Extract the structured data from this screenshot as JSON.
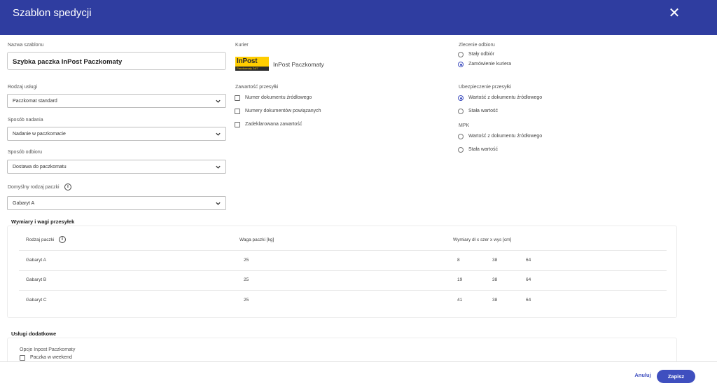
{
  "header": {
    "title": "Szablon spedycji",
    "close_icon": "close-icon"
  },
  "template_name": {
    "label": "Nazwa szablonu",
    "value": "Szybka paczka InPost Paczkomaty"
  },
  "courier": {
    "label": "Kurier",
    "logo_text": "InPost",
    "logo_subtext": "Paczkomaty 24/7",
    "name": "InPost Paczkomaty"
  },
  "pickup_order": {
    "label": "Zlecenie odbioru",
    "options": [
      {
        "label": "Stały odbiór",
        "selected": false
      },
      {
        "label": "Zamówienie kuriera",
        "selected": true
      }
    ]
  },
  "service_type": {
    "label": "Rodzaj usługi",
    "value": "Paczkomat standard"
  },
  "shipment_content": {
    "label": "Zawartość przesyłki",
    "options": [
      {
        "label": "Numer dokumentu źródłowego",
        "checked": false
      },
      {
        "label": "Numery dokumentów powiązanych",
        "checked": false
      },
      {
        "label": "Zadeklarowana zawartość",
        "checked": false
      }
    ]
  },
  "insurance": {
    "label": "Ubezpieczenie przesyłki",
    "options": [
      {
        "label": "Wartość z dokumentu źródłowego",
        "selected": true
      },
      {
        "label": "Stała wartość",
        "selected": false
      }
    ]
  },
  "mpk": {
    "label": "MPK",
    "options": [
      {
        "label": "Wartość z dokumentu źródłowego",
        "selected": false
      },
      {
        "label": "Stała wartość",
        "selected": false
      }
    ]
  },
  "dispatch_method": {
    "label": "Sposób nadania",
    "value": "Nadanie w paczkomacie"
  },
  "delivery_method": {
    "label": "Sposób odbioru",
    "value": "Dostawa do paczkomatu"
  },
  "default_package": {
    "label": "Domyślny rodzaj paczki",
    "value": "Gabaryt A",
    "info_icon": "info-icon"
  },
  "dimensions": {
    "title": "Wymiary i wagi przesyłek",
    "columns": [
      "Rodzaj paczki",
      "Waga paczki [kg]",
      "Wymiary dł x szer x wys [cm]"
    ],
    "rows": [
      {
        "type": "Gabaryt A",
        "weight": "25",
        "length": "8",
        "width": "38",
        "height": "64"
      },
      {
        "type": "Gabaryt B",
        "weight": "25",
        "length": "19",
        "width": "38",
        "height": "64"
      },
      {
        "type": "Gabaryt C",
        "weight": "25",
        "length": "41",
        "width": "38",
        "height": "64"
      }
    ]
  },
  "extra_services": {
    "title": "Usługi dodatkowe",
    "group_label": "Opcje Inpost Paczkomaty",
    "options": [
      {
        "label": "Paczka w weekend",
        "checked": false
      }
    ]
  },
  "footer": {
    "cancel_label": "Anuluj",
    "save_label": "Zapisz"
  },
  "colors": {
    "header": "#2f3da0",
    "accent": "#3f4fbf"
  }
}
